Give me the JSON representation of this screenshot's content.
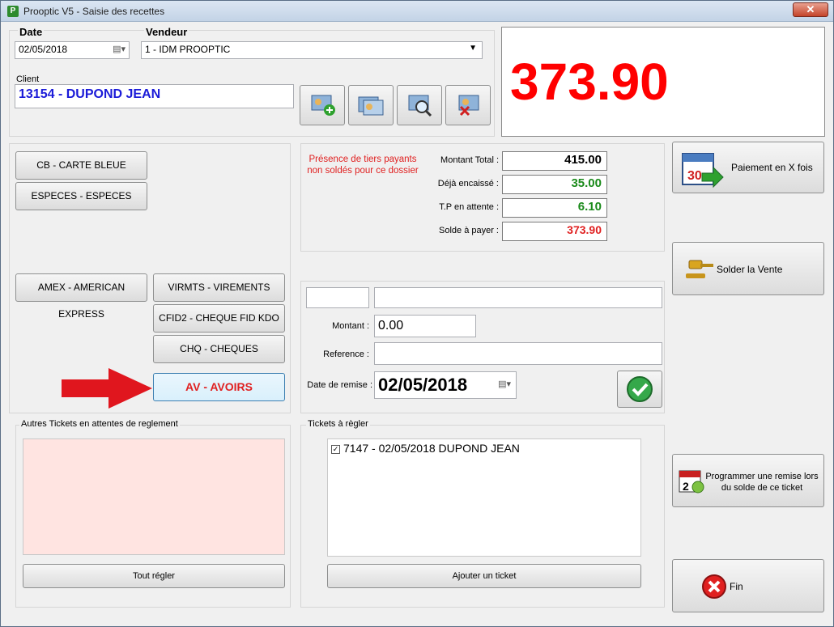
{
  "window": {
    "title": "Prooptic V5 - Saisie des recettes",
    "close_label": "✕",
    "app_icon": "P"
  },
  "date": {
    "label": "Date",
    "value": "02/05/2018"
  },
  "vendeur": {
    "label": "Vendeur",
    "value": "1 - IDM PROOPTIC"
  },
  "client": {
    "label": "Client",
    "value": "13154 - DUPOND JEAN"
  },
  "display": {
    "total": "373.90"
  },
  "payment_buttons": {
    "cb": "CB - CARTE BLEUE",
    "especes": "ESPECES - ESPECES",
    "amex": "AMEX - AMERICAN EXPRESS",
    "virmts": "VIRMTS - VIREMENTS",
    "cfid2": "CFID2 - CHEQUE FID KDO",
    "chq": "CHQ - CHEQUES",
    "avoirs": "AV - AVOIRS"
  },
  "notice": "Présence de tiers payants non soldés pour ce dossier",
  "totals": {
    "montant_total_label": "Montant Total :",
    "montant_total": "415.00",
    "deja_encaisse_label": "Déjà encaissé :",
    "deja_encaisse": "35.00",
    "tp_attente_label": "T.P en attente :",
    "tp_attente": "6.10",
    "solde_label": "Solde à payer :",
    "solde": "373.90"
  },
  "entry": {
    "montant_label": "Montant :",
    "montant": "0.00",
    "reference_label": "Reference :",
    "date_remise_label": "Date de remise :",
    "date_remise": "02/05/2018"
  },
  "right_buttons": {
    "paiement_x": "Paiement en X fois",
    "solder": "Solder la Vente",
    "programmer": "Programmer une remise lors du solde de ce ticket",
    "fin": "Fin"
  },
  "autres": {
    "title": "Autres Tickets en attentes de reglement",
    "button": "Tout régler"
  },
  "tickets": {
    "title": "Tickets à règler",
    "items": [
      "7147 - 02/05/2018 DUPOND JEAN"
    ],
    "button": "Ajouter un ticket"
  },
  "colors": {
    "display_red": "#ff0000",
    "client_blue": "#1a1ad8",
    "green_amount": "#1a8a1a",
    "red_amount": "#e02020",
    "pink_panel": "#ffe4e1",
    "arrow_red": "#e0161e"
  }
}
